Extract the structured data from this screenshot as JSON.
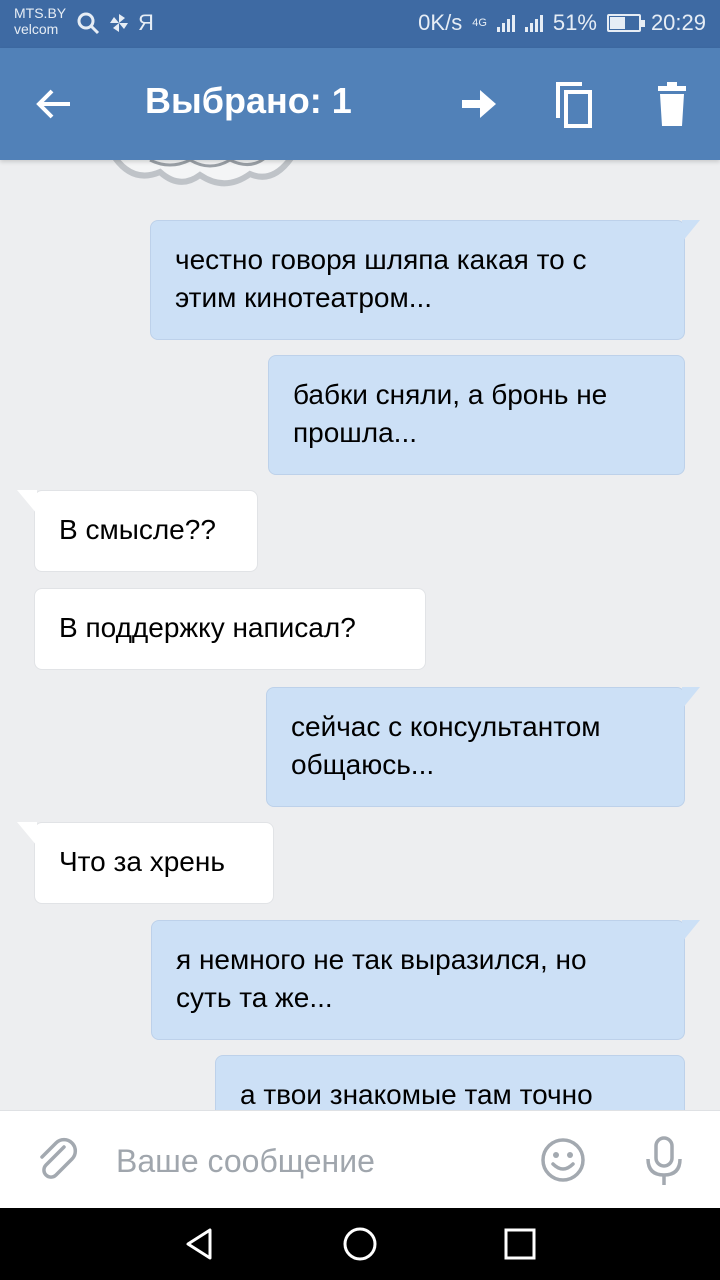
{
  "status_bar": {
    "carrier1": "MTS.BY",
    "carrier2": "velcom",
    "letter": "Я",
    "speed": "0K/s",
    "network_type": "4G",
    "battery": "51%",
    "battery_level": 0.51,
    "time": "20:29"
  },
  "toolbar": {
    "title": "Выбрано: 1",
    "icons": [
      "back-arrow-icon",
      "forward-icon",
      "copy-icon",
      "trash-icon"
    ]
  },
  "messages": [
    {
      "direction": "out",
      "text_line1": "честно говоря шляпа какая то с",
      "text_line2": "этим кинотеатром..."
    },
    {
      "direction": "out",
      "text_line1": "бабки сняли, а бронь не",
      "text_line2": "прошла..."
    },
    {
      "direction": "in",
      "text_line1": "В смысле??"
    },
    {
      "direction": "in",
      "text_line1": "В поддержку написал?"
    },
    {
      "direction": "out",
      "text_line1": "сейчас с консультантом",
      "text_line2": "общаюсь..."
    },
    {
      "direction": "in",
      "text_line1": "Что за хрень"
    },
    {
      "direction": "out",
      "text_line1": "я немного не так выразился, но",
      "text_line2": "суть та же..."
    },
    {
      "direction": "out",
      "text_line1": "а твои знакомые там точно"
    }
  ],
  "input": {
    "placeholder": "Ваше сообщение",
    "icons": [
      "attach-icon",
      "emoji-icon",
      "mic-icon"
    ]
  },
  "colors": {
    "statusbar": "#3e6aa3",
    "toolbar": "#5181b8",
    "background": "#edeef0",
    "outgoing_bubble": "#cce0f6",
    "incoming_bubble": "#ffffff"
  }
}
